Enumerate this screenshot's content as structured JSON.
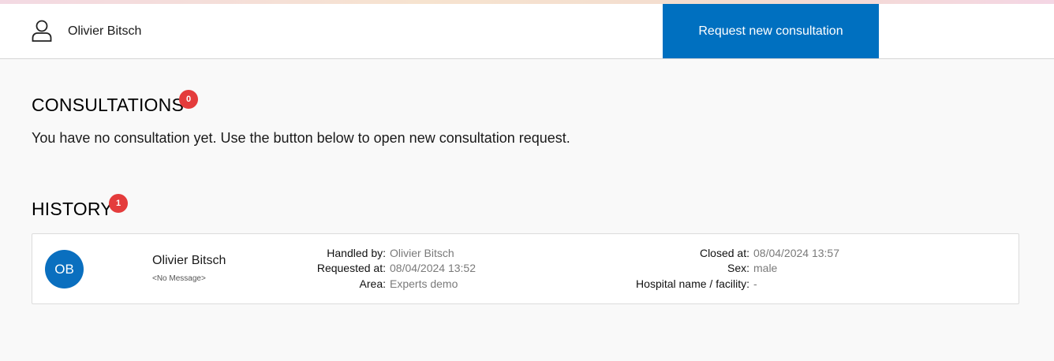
{
  "header": {
    "user_name": "Olivier Bitsch",
    "request_button_label": "Request new consultation"
  },
  "consultations": {
    "title": "CONSULTATIONS",
    "count": "0",
    "empty_message": "You have no consultation yet. Use the button below to open new consultation request."
  },
  "history": {
    "title": "HISTORY",
    "count": "1",
    "items": [
      {
        "avatar_initials": "OB",
        "name": "Olivier Bitsch",
        "message": "<No Message>",
        "handled_by_label": "Handled by:",
        "handled_by": "Olivier Bitsch",
        "requested_at_label": "Requested at:",
        "requested_at": "08/04/2024 13:52",
        "area_label": "Area:",
        "area": "Experts demo",
        "closed_at_label": "Closed at:",
        "closed_at": "08/04/2024 13:57",
        "sex_label": "Sex:",
        "sex": "male",
        "hospital_label": "Hospital name / facility:",
        "hospital": "-"
      }
    ]
  },
  "colors": {
    "primary": "#0070c0",
    "badge": "#e43c3c",
    "background": "#f9f9f9"
  },
  "icons": {
    "user": "user-outline-icon"
  }
}
